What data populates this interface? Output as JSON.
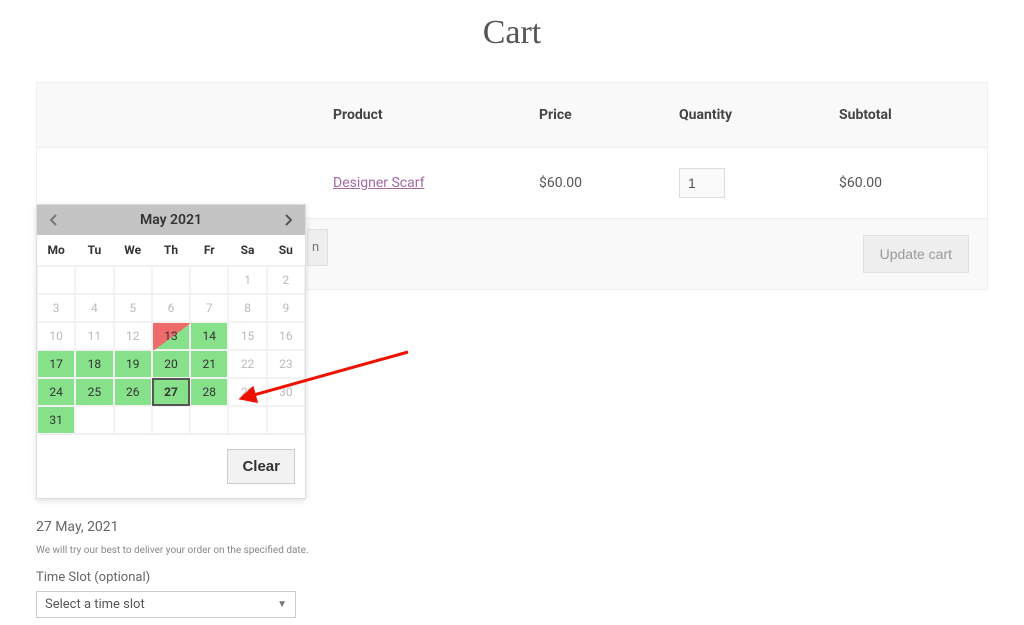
{
  "page": {
    "title": "Cart"
  },
  "table": {
    "headers": {
      "product": "Product",
      "price": "Price",
      "quantity": "Quantity",
      "subtotal": "Subtotal"
    },
    "row": {
      "product": "Designer Scarf",
      "price": "$60.00",
      "quantity": "1",
      "subtotal": "$60.00"
    }
  },
  "actions": {
    "coupon_stub": "n",
    "update_cart": "Update cart"
  },
  "datepicker": {
    "month_label": "May 2021",
    "dow": [
      "Mo",
      "Tu",
      "We",
      "Th",
      "Fr",
      "Sa",
      "Su"
    ],
    "weeks": [
      [
        {
          "n": ""
        },
        {
          "n": ""
        },
        {
          "n": ""
        },
        {
          "n": ""
        },
        {
          "n": ""
        },
        {
          "n": "1"
        },
        {
          "n": "2"
        }
      ],
      [
        {
          "n": "3"
        },
        {
          "n": "4"
        },
        {
          "n": "5"
        },
        {
          "n": "6"
        },
        {
          "n": "7"
        },
        {
          "n": "8"
        },
        {
          "n": "9"
        }
      ],
      [
        {
          "n": "10"
        },
        {
          "n": "11"
        },
        {
          "n": "12"
        },
        {
          "n": "13",
          "state": "partial"
        },
        {
          "n": "14",
          "state": "enabled"
        },
        {
          "n": "15"
        },
        {
          "n": "16"
        }
      ],
      [
        {
          "n": "17",
          "state": "enabled"
        },
        {
          "n": "18",
          "state": "enabled"
        },
        {
          "n": "19",
          "state": "enabled"
        },
        {
          "n": "20",
          "state": "enabled"
        },
        {
          "n": "21",
          "state": "enabled"
        },
        {
          "n": "22"
        },
        {
          "n": "23"
        }
      ],
      [
        {
          "n": "24",
          "state": "enabled"
        },
        {
          "n": "25",
          "state": "enabled"
        },
        {
          "n": "26",
          "state": "enabled"
        },
        {
          "n": "27",
          "state": "enabled",
          "selected": true
        },
        {
          "n": "28",
          "state": "enabled"
        },
        {
          "n": "29"
        },
        {
          "n": "30"
        }
      ],
      [
        {
          "n": "31",
          "state": "enabled"
        },
        {
          "n": ""
        },
        {
          "n": ""
        },
        {
          "n": ""
        },
        {
          "n": ""
        },
        {
          "n": ""
        },
        {
          "n": ""
        }
      ]
    ],
    "clear_label": "Clear"
  },
  "below": {
    "selected_date": "27 May, 2021",
    "note": "We will try our best to deliver your order on the specified date.",
    "timeslot_label": "Time Slot (optional)",
    "timeslot_placeholder": "Select a time slot"
  }
}
